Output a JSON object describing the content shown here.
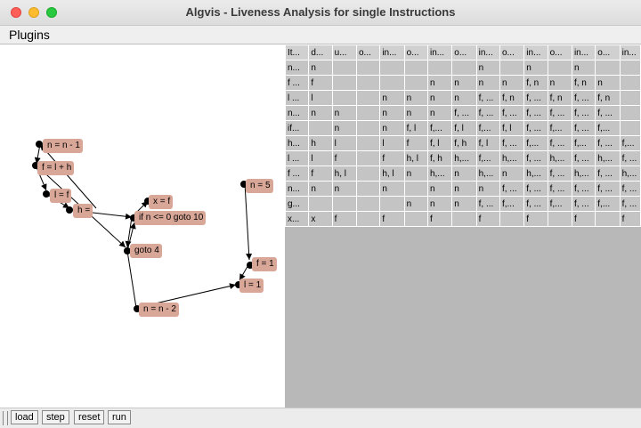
{
  "window": {
    "title": "Algvis - Liveness Analysis for single Instructions"
  },
  "menu": {
    "plugins": "Plugins"
  },
  "colors": {
    "node_fill": "#d9a797",
    "table_bg": "#b8b8b8",
    "cell_bg": "#c4c4c4"
  },
  "graph": {
    "nodes": [
      {
        "id": "n1",
        "label": "n = n - 1"
      },
      {
        "id": "n2",
        "label": "f = l + h"
      },
      {
        "id": "n3",
        "label": "l = f"
      },
      {
        "id": "n4",
        "label": "h ="
      },
      {
        "id": "n5",
        "label": "x = f"
      },
      {
        "id": "n6",
        "label": "if n <= 0 goto 10"
      },
      {
        "id": "n7",
        "label": "goto 4"
      },
      {
        "id": "n8",
        "label": "n = n - 2"
      },
      {
        "id": "n9",
        "label": "n = 5"
      },
      {
        "id": "n10",
        "label": "f = 1"
      },
      {
        "id": "n11",
        "label": "l = 1"
      }
    ]
  },
  "table": {
    "headers": [
      "It...",
      "d...",
      "u...",
      "o...",
      "in...",
      "o...",
      "in...",
      "o...",
      "in...",
      "o...",
      "in...",
      "o...",
      "in...",
      "o...",
      "in..."
    ],
    "rows": [
      [
        "n...",
        "n",
        "",
        "",
        "",
        "",
        "",
        "",
        "n",
        "",
        "n",
        "",
        "n",
        "",
        ""
      ],
      [
        "f ...",
        "f",
        "",
        "",
        "",
        "",
        "n",
        "n",
        "n",
        "n",
        "f, n",
        "n",
        "f, n",
        "n",
        ""
      ],
      [
        "l ...",
        "l",
        "",
        "",
        "n",
        "n",
        "n",
        "n",
        "f, ...",
        "f, n",
        "f, ...",
        "f, n",
        "f, ...",
        "f, n",
        ""
      ],
      [
        "n...",
        "n",
        "n",
        "",
        "n",
        "n",
        "n",
        "f, ...",
        "f, ...",
        "f, ...",
        "f, ...",
        "f, ...",
        "f, ...",
        "f, ...",
        ""
      ],
      [
        "if...",
        "",
        "n",
        "",
        "n",
        "f, l",
        "f,...",
        "f, l",
        "f,...",
        "f, l",
        "f, ...",
        "f,...",
        "f, ...",
        "f,...",
        ""
      ],
      [
        "h...",
        "h",
        "l",
        "",
        "l",
        "f",
        "f, l",
        "f, h",
        "f, l",
        "f, ...",
        "f,...",
        "f, ...",
        "f,...",
        "f, ...",
        "f,..."
      ],
      [
        "l ...",
        "l",
        "f",
        "",
        "f",
        "h, l",
        "f, h",
        "h,...",
        "f,...",
        "h,...",
        "f, ...",
        "h,...",
        "f, ...",
        "h,...",
        "f, ..."
      ],
      [
        "f ...",
        "f",
        "h, l",
        "",
        "h, l",
        "n",
        "h,...",
        "n",
        "h,...",
        "n",
        "h,...",
        "f, ...",
        "h,...",
        "f, ...",
        "h,..."
      ],
      [
        "n...",
        "n",
        "n",
        "",
        "n",
        "",
        "n",
        "n",
        "n",
        "f, ...",
        "f, ...",
        "f, ...",
        "f, ...",
        "f, ...",
        "f, ..."
      ],
      [
        "g...",
        "",
        "",
        "",
        "",
        "n",
        "n",
        "n",
        "f, ...",
        "f,...",
        "f, ...",
        "f,...",
        "f, ...",
        "f,...",
        "f, ..."
      ],
      [
        "x...",
        "x",
        "f",
        "",
        "f",
        "",
        "f",
        "",
        "f",
        "",
        "f",
        "",
        "f",
        "",
        "f"
      ]
    ]
  },
  "toolbar": {
    "load": "load",
    "step": "step",
    "reset": "reset",
    "run": "run"
  }
}
